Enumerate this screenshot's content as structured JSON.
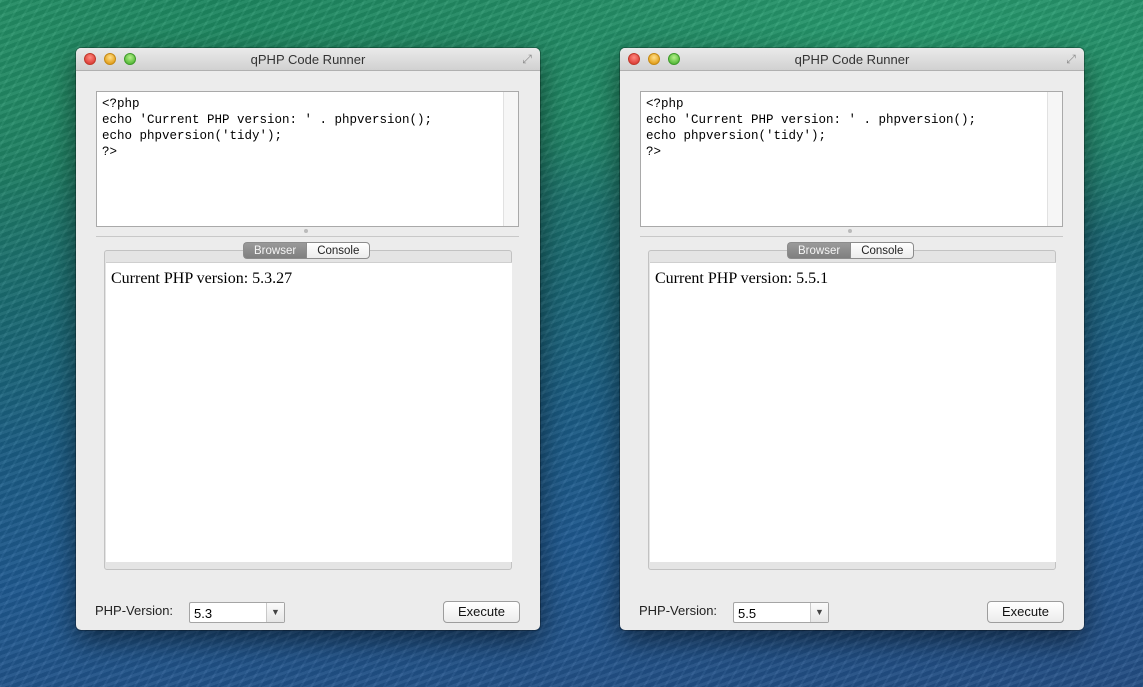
{
  "windows": [
    {
      "title": "qPHP Code Runner",
      "code": "<?php\necho 'Current PHP version: ' . phpversion();\necho phpversion('tidy');\n?>",
      "tabs": {
        "browser": "Browser",
        "console": "Console"
      },
      "output": "Current PHP version: 5.3.27",
      "version_label": "PHP-Version:",
      "version_value": "5.3",
      "execute_label": "Execute"
    },
    {
      "title": "qPHP Code Runner",
      "code": "<?php\necho 'Current PHP version: ' . phpversion();\necho phpversion('tidy');\n?>",
      "tabs": {
        "browser": "Browser",
        "console": "Console"
      },
      "output": "Current PHP version: 5.5.1",
      "version_label": "PHP-Version:",
      "version_value": "5.5",
      "execute_label": "Execute"
    }
  ],
  "icons": {
    "dropdown": "chevron-down-icon",
    "fullscreen": "fullscreen-icon"
  }
}
